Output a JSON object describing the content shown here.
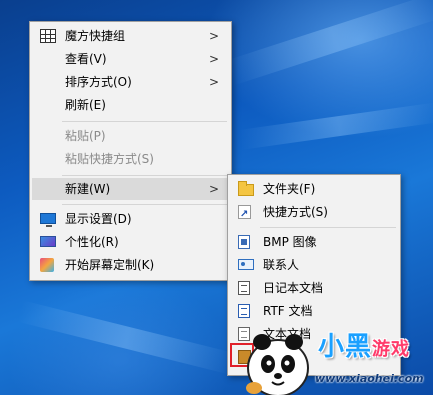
{
  "colors": {
    "desktop_accent": "#0d5bc0",
    "menu_bg": "#f2f2f2",
    "highlight": "#dadada",
    "disabled_text": "#8a8a8a"
  },
  "context_menu": {
    "items": [
      {
        "label": "魔方快捷组",
        "icon": "grid-icon",
        "has_submenu": true,
        "disabled": false
      },
      {
        "label": "查看(V)",
        "has_submenu": true,
        "disabled": false
      },
      {
        "label": "排序方式(O)",
        "has_submenu": true,
        "disabled": false
      },
      {
        "label": "刷新(E)",
        "has_submenu": false,
        "disabled": false
      },
      {
        "label": "粘贴(P)",
        "has_submenu": false,
        "disabled": true
      },
      {
        "label": "粘贴快捷方式(S)",
        "has_submenu": false,
        "disabled": true
      },
      {
        "label": "新建(W)",
        "has_submenu": true,
        "disabled": false,
        "highlighted": true
      },
      {
        "label": "显示设置(D)",
        "icon": "monitor-icon",
        "has_submenu": false,
        "disabled": false
      },
      {
        "label": "个性化(R)",
        "icon": "personalize-icon",
        "has_submenu": false,
        "disabled": false
      },
      {
        "label": "开始屏幕定制(K)",
        "icon": "start-screen-icon",
        "has_submenu": false,
        "disabled": false
      }
    ],
    "arrow_glyph": ">"
  },
  "new_submenu": {
    "items": [
      {
        "label": "文件夹(F)",
        "icon": "folder-icon"
      },
      {
        "label": "快捷方式(S)",
        "icon": "shortcut-icon"
      },
      {
        "label": "BMP 图像",
        "icon": "bitmap-icon"
      },
      {
        "label": "联系人",
        "icon": "contact-icon"
      },
      {
        "label": "日记本文档",
        "icon": "journal-icon"
      },
      {
        "label": "RTF 文档",
        "icon": "rtf-document-icon"
      },
      {
        "label": "文本文档",
        "icon": "text-document-icon"
      },
      {
        "label": "",
        "icon": "zip-icon"
      }
    ]
  },
  "watermark": {
    "brand": "小黑",
    "game": "游戏",
    "url": "www.xiaohei.com"
  }
}
